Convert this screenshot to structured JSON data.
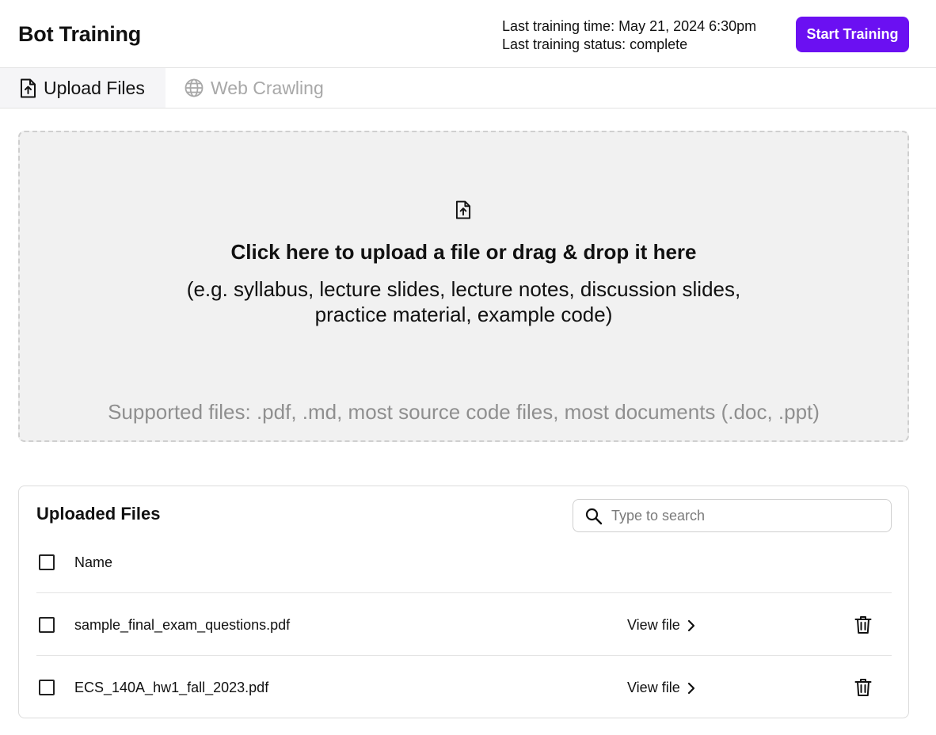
{
  "header": {
    "title": "Bot Training",
    "last_training_time": "Last training time: May 21, 2024 6:30pm",
    "last_training_status": "Last training status: complete",
    "start_button": "Start Training",
    "accent_color": "#6b10f2"
  },
  "tabs": [
    {
      "label": "Upload Files",
      "icon": "file-upload-icon",
      "active": true
    },
    {
      "label": "Web Crawling",
      "icon": "globe-icon",
      "active": false
    }
  ],
  "dropzone": {
    "icon": "file-upload-icon",
    "title": "Click here to upload a file or drag & drop it here",
    "subtitle_line1": "(e.g. syllabus, lecture slides, lecture notes, discussion slides,",
    "subtitle_line2": "practice material, example code)",
    "supported": "Supported files: .pdf, .md, most source code files, most documents (.doc, .ppt)"
  },
  "files": {
    "title": "Uploaded Files",
    "search_placeholder": "Type to search",
    "search_value": "",
    "column_name": "Name",
    "rows": [
      {
        "name": "sample_final_exam_questions.pdf",
        "view_label": "View file"
      },
      {
        "name": "ECS_140A_hw1_fall_2023.pdf",
        "view_label": "View file"
      }
    ]
  }
}
